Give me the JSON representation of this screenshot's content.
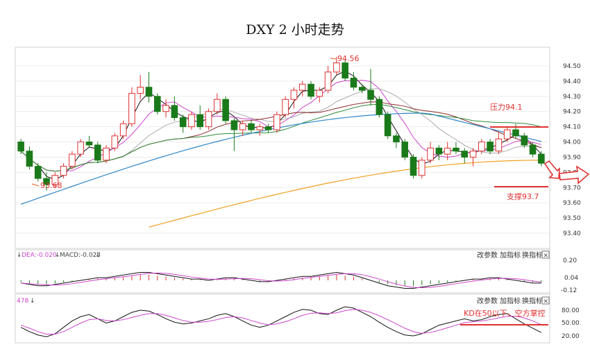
{
  "title": "DXY 2 小时走势",
  "main": {
    "y_ticks": [
      "94.50",
      "94.40",
      "94.30",
      "94.20",
      "94.10",
      "94.00",
      "93.90",
      "93.80",
      "93.70",
      "93.60",
      "93.50",
      "93.40"
    ],
    "low_label": "93.68",
    "high_label": "94.56",
    "resistance_label": "压力94.1",
    "support_label": "支撑93.7"
  },
  "macd": {
    "dea_label": "DEA:-0.020",
    "macd_label": "MACD:-0.023",
    "y_ticks": [
      "0.20",
      "0.04",
      "-0.12"
    ],
    "controls": [
      "改参数",
      "加指标",
      "换指标"
    ]
  },
  "kd": {
    "left_label": "478",
    "note": "KD在50以下，空方掌控",
    "y_ticks": [
      "80.00",
      "50.00",
      "20.00"
    ],
    "controls": [
      "改参数",
      "加指标",
      "换指标"
    ]
  },
  "colors": {
    "up": "#e03030",
    "down": "#1a7a1a",
    "accent": "#e03030",
    "ma_fast": "#111111",
    "ma_mid": "#cc44cc",
    "ma_long": "#2f86c8",
    "ma_orange": "#f0a020"
  },
  "chart_data": {
    "type": "candlestick",
    "ylim": [
      93.35,
      94.55
    ],
    "candles": [
      {
        "o": 94.0,
        "h": 94.02,
        "l": 93.92,
        "c": 93.94
      },
      {
        "o": 93.94,
        "h": 93.97,
        "l": 93.82,
        "c": 93.84
      },
      {
        "o": 93.84,
        "h": 93.86,
        "l": 93.74,
        "c": 93.76
      },
      {
        "o": 93.76,
        "h": 93.8,
        "l": 93.68,
        "c": 93.72
      },
      {
        "o": 93.72,
        "h": 93.8,
        "l": 93.7,
        "c": 93.78
      },
      {
        "o": 93.78,
        "h": 93.86,
        "l": 93.76,
        "c": 93.84
      },
      {
        "o": 93.84,
        "h": 93.94,
        "l": 93.82,
        "c": 93.92
      },
      {
        "o": 93.92,
        "h": 94.02,
        "l": 93.9,
        "c": 94.0
      },
      {
        "o": 94.0,
        "h": 94.04,
        "l": 93.96,
        "c": 93.98
      },
      {
        "o": 93.98,
        "h": 94.0,
        "l": 93.86,
        "c": 93.88
      },
      {
        "o": 93.88,
        "h": 93.98,
        "l": 93.86,
        "c": 93.96
      },
      {
        "o": 93.96,
        "h": 94.06,
        "l": 93.94,
        "c": 94.04
      },
      {
        "o": 94.04,
        "h": 94.14,
        "l": 94.02,
        "c": 94.12
      },
      {
        "o": 94.12,
        "h": 94.36,
        "l": 94.1,
        "c": 94.32
      },
      {
        "o": 94.32,
        "h": 94.44,
        "l": 94.28,
        "c": 94.36
      },
      {
        "o": 94.36,
        "h": 94.46,
        "l": 94.26,
        "c": 94.3
      },
      {
        "o": 94.3,
        "h": 94.32,
        "l": 94.18,
        "c": 94.2
      },
      {
        "o": 94.2,
        "h": 94.28,
        "l": 94.16,
        "c": 94.24
      },
      {
        "o": 94.24,
        "h": 94.3,
        "l": 94.14,
        "c": 94.16
      },
      {
        "o": 94.16,
        "h": 94.18,
        "l": 94.06,
        "c": 94.1
      },
      {
        "o": 94.1,
        "h": 94.2,
        "l": 94.08,
        "c": 94.18
      },
      {
        "o": 94.18,
        "h": 94.24,
        "l": 94.08,
        "c": 94.1
      },
      {
        "o": 94.1,
        "h": 94.22,
        "l": 94.08,
        "c": 94.2
      },
      {
        "o": 94.2,
        "h": 94.32,
        "l": 94.18,
        "c": 94.28
      },
      {
        "o": 94.28,
        "h": 94.3,
        "l": 94.12,
        "c": 94.14
      },
      {
        "o": 94.14,
        "h": 94.16,
        "l": 93.94,
        "c": 94.08
      },
      {
        "o": 94.08,
        "h": 94.14,
        "l": 94.04,
        "c": 94.12
      },
      {
        "o": 94.12,
        "h": 94.14,
        "l": 94.06,
        "c": 94.08
      },
      {
        "o": 94.08,
        "h": 94.12,
        "l": 94.04,
        "c": 94.1
      },
      {
        "o": 94.1,
        "h": 94.12,
        "l": 94.06,
        "c": 94.08
      },
      {
        "o": 94.08,
        "h": 94.2,
        "l": 94.06,
        "c": 94.18
      },
      {
        "o": 94.18,
        "h": 94.3,
        "l": 94.16,
        "c": 94.28
      },
      {
        "o": 94.28,
        "h": 94.36,
        "l": 94.22,
        "c": 94.34
      },
      {
        "o": 94.34,
        "h": 94.4,
        "l": 94.3,
        "c": 94.38
      },
      {
        "o": 94.38,
        "h": 94.4,
        "l": 94.28,
        "c": 94.3
      },
      {
        "o": 94.3,
        "h": 94.36,
        "l": 94.26,
        "c": 94.34
      },
      {
        "o": 94.34,
        "h": 94.5,
        "l": 94.32,
        "c": 94.46
      },
      {
        "o": 94.46,
        "h": 94.56,
        "l": 94.44,
        "c": 94.52
      },
      {
        "o": 94.52,
        "h": 94.54,
        "l": 94.4,
        "c": 94.42
      },
      {
        "o": 94.42,
        "h": 94.46,
        "l": 94.34,
        "c": 94.36
      },
      {
        "o": 94.36,
        "h": 94.38,
        "l": 94.32,
        "c": 94.34
      },
      {
        "o": 94.34,
        "h": 94.48,
        "l": 94.24,
        "c": 94.28
      },
      {
        "o": 94.28,
        "h": 94.3,
        "l": 94.16,
        "c": 94.18
      },
      {
        "o": 94.18,
        "h": 94.2,
        "l": 94.02,
        "c": 94.04
      },
      {
        "o": 94.04,
        "h": 94.06,
        "l": 93.96,
        "c": 94.0
      },
      {
        "o": 94.0,
        "h": 94.02,
        "l": 93.88,
        "c": 93.9
      },
      {
        "o": 93.9,
        "h": 93.92,
        "l": 93.76,
        "c": 93.78
      },
      {
        "o": 93.78,
        "h": 93.9,
        "l": 93.76,
        "c": 93.88
      },
      {
        "o": 93.88,
        "h": 94.0,
        "l": 93.86,
        "c": 93.96
      },
      {
        "o": 93.96,
        "h": 93.98,
        "l": 93.88,
        "c": 93.92
      },
      {
        "o": 93.92,
        "h": 94.0,
        "l": 93.88,
        "c": 93.96
      },
      {
        "o": 93.96,
        "h": 94.0,
        "l": 93.92,
        "c": 93.94
      },
      {
        "o": 93.94,
        "h": 93.96,
        "l": 93.86,
        "c": 93.9
      },
      {
        "o": 93.9,
        "h": 93.96,
        "l": 93.84,
        "c": 93.94
      },
      {
        "o": 93.94,
        "h": 94.02,
        "l": 93.92,
        "c": 94.0
      },
      {
        "o": 94.0,
        "h": 94.02,
        "l": 93.92,
        "c": 93.94
      },
      {
        "o": 93.94,
        "h": 94.06,
        "l": 93.92,
        "c": 94.02
      },
      {
        "o": 94.02,
        "h": 94.1,
        "l": 94.0,
        "c": 94.08
      },
      {
        "o": 94.08,
        "h": 94.12,
        "l": 94.02,
        "c": 94.04
      },
      {
        "o": 94.04,
        "h": 94.06,
        "l": 93.96,
        "c": 93.98
      },
      {
        "o": 93.98,
        "h": 94.0,
        "l": 93.9,
        "c": 93.92
      },
      {
        "o": 93.92,
        "h": 93.94,
        "l": 93.84,
        "c": 93.86
      }
    ],
    "macd_bars": [
      -0.02,
      -0.03,
      -0.04,
      -0.04,
      -0.03,
      -0.02,
      -0.01,
      0.0,
      0.01,
      0.02,
      0.02,
      0.03,
      0.04,
      0.05,
      0.06,
      0.06,
      0.05,
      0.04,
      0.03,
      0.02,
      0.01,
      0.01,
      0.0,
      0.01,
      0.02,
      0.02,
      0.01,
      0.0,
      -0.01,
      -0.01,
      0.0,
      0.01,
      0.02,
      0.03,
      0.03,
      0.04,
      0.05,
      0.06,
      0.05,
      0.04,
      0.02,
      0.0,
      -0.02,
      -0.04,
      -0.05,
      -0.06,
      -0.06,
      -0.05,
      -0.04,
      -0.03,
      -0.02,
      -0.01,
      0.0,
      0.01,
      0.01,
      0.02,
      0.02,
      0.01,
      0.0,
      -0.01,
      -0.02,
      -0.02
    ],
    "kd_k": [
      40,
      30,
      22,
      18,
      25,
      40,
      55,
      65,
      70,
      60,
      50,
      55,
      65,
      75,
      80,
      78,
      70,
      60,
      52,
      48,
      50,
      55,
      60,
      68,
      72,
      65,
      55,
      45,
      40,
      45,
      55,
      65,
      75,
      82,
      80,
      72,
      70,
      80,
      88,
      85,
      75,
      65,
      52,
      40,
      30,
      22,
      20,
      25,
      35,
      45,
      50,
      55,
      60,
      55,
      58,
      65,
      70,
      72,
      60,
      48,
      38,
      28
    ],
    "kd_d": [
      45,
      38,
      30,
      24,
      24,
      30,
      40,
      50,
      58,
      60,
      56,
      55,
      58,
      63,
      68,
      72,
      72,
      68,
      62,
      56,
      52,
      52,
      54,
      58,
      63,
      65,
      62,
      56,
      50,
      46,
      48,
      53,
      60,
      68,
      73,
      74,
      72,
      74,
      79,
      82,
      80,
      75,
      67,
      58,
      48,
      38,
      30,
      26,
      28,
      33,
      39,
      45,
      51,
      53,
      55,
      58,
      62,
      66,
      66,
      62,
      55,
      46
    ]
  }
}
